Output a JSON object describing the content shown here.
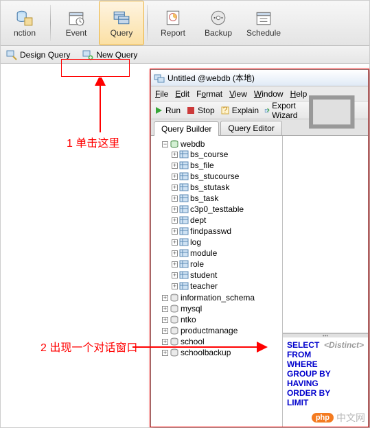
{
  "toolbar": {
    "items": [
      {
        "label": "nction",
        "icon": "connection-icon"
      },
      {
        "label": "Event",
        "icon": "event-icon"
      },
      {
        "label": "Query",
        "icon": "query-icon",
        "selected": true
      },
      {
        "label": "Report",
        "icon": "report-icon"
      },
      {
        "label": "Backup",
        "icon": "backup-icon"
      },
      {
        "label": "Schedule",
        "icon": "schedule-icon"
      }
    ]
  },
  "subbar": {
    "design_query": "Design Query",
    "new_query": "New Query"
  },
  "dialog": {
    "title": "Untitled @webdb (本地)",
    "menu": {
      "file": "File",
      "edit": "Edit",
      "format": "Format",
      "view": "View",
      "window": "Window",
      "help": "Help"
    },
    "actions": {
      "run": "Run",
      "stop": "Stop",
      "explain": "Explain",
      "export": "Export Wizard"
    },
    "tabs": {
      "builder": "Query Builder",
      "editor": "Query Editor"
    },
    "tree": {
      "root": "webdb",
      "tables": [
        "bs_course",
        "bs_file",
        "bs_stucourse",
        "bs_stutask",
        "bs_task",
        "c3p0_testtable",
        "dept",
        "findpasswd",
        "log",
        "module",
        "role",
        "student",
        "teacher"
      ],
      "other_dbs": [
        "information_schema",
        "mysql",
        "ntko",
        "productmanage",
        "school",
        "schoolbackup"
      ]
    },
    "sql": {
      "keywords": [
        "SELECT",
        "FROM",
        "WHERE",
        "GROUP BY",
        "HAVING",
        "ORDER BY",
        "LIMIT"
      ],
      "distinct_hint": "<Distinct>"
    }
  },
  "annotations": {
    "step1": "1 单击这里",
    "step2": "2 出现一个对话窗口"
  },
  "watermark": {
    "badge": "php",
    "text": "中文网"
  }
}
